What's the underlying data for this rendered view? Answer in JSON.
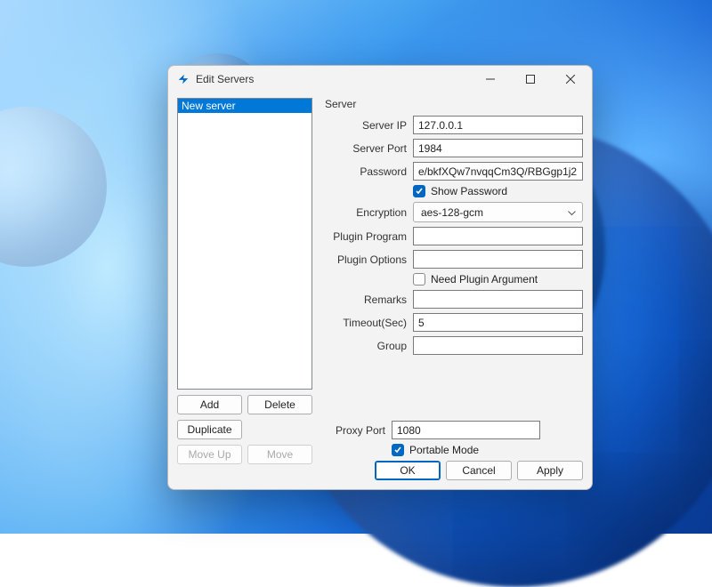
{
  "window": {
    "title": "Edit Servers"
  },
  "sidebar": {
    "items": [
      {
        "label": "New server",
        "selected": true
      }
    ],
    "buttons": {
      "add": "Add",
      "delete": "Delete",
      "duplicate": "Duplicate",
      "move_up": "Move Up",
      "move_down": "Move"
    }
  },
  "form": {
    "group_label": "Server",
    "server_ip": {
      "label": "Server IP",
      "value": "127.0.0.1"
    },
    "server_port": {
      "label": "Server Port",
      "value": "1984"
    },
    "password": {
      "label": "Password",
      "value": "e/bkfXQw7nvqqCm3Q/RBGgp1j2"
    },
    "show_password": {
      "label": "Show Password",
      "checked": true
    },
    "encryption": {
      "label": "Encryption",
      "value": "aes-128-gcm"
    },
    "plugin_program": {
      "label": "Plugin Program",
      "value": ""
    },
    "plugin_options": {
      "label": "Plugin Options",
      "value": ""
    },
    "need_plugin_arg": {
      "label": "Need Plugin Argument",
      "checked": false
    },
    "remarks": {
      "label": "Remarks",
      "value": ""
    },
    "timeout_sec": {
      "label": "Timeout(Sec)",
      "value": "5"
    },
    "group": {
      "label": "Group",
      "value": ""
    }
  },
  "footer": {
    "proxy_port": {
      "label": "Proxy Port",
      "value": "1080"
    },
    "portable_mode": {
      "label": "Portable Mode",
      "checked": true
    },
    "ok": "OK",
    "cancel": "Cancel",
    "apply": "Apply"
  }
}
